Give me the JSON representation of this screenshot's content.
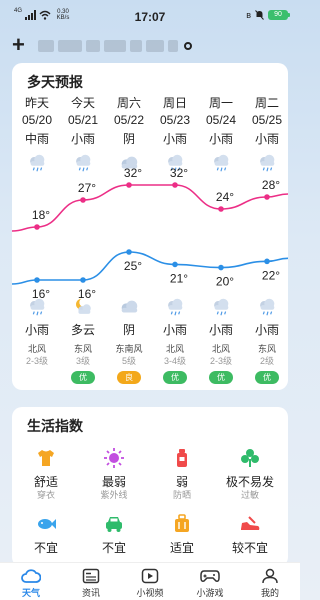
{
  "status_bar": {
    "network": "4G",
    "speed_value": "0.30",
    "speed_unit": "KB/s",
    "time": "17:07",
    "battery": "90"
  },
  "header": {
    "add_label": "+"
  },
  "forecast": {
    "title": "多天预报",
    "days": [
      {
        "name": "昨天",
        "date": "05/20",
        "day_cond": "中雨",
        "high": "18°",
        "low": "16°",
        "night_cond": "小雨",
        "wind_dir": "北风",
        "wind_level": "2-3级",
        "aqi": ""
      },
      {
        "name": "今天",
        "date": "05/21",
        "day_cond": "小雨",
        "high": "27°",
        "low": "16°",
        "night_cond": "多云",
        "wind_dir": "东风",
        "wind_level": "3级",
        "aqi": "优"
      },
      {
        "name": "周六",
        "date": "05/22",
        "day_cond": "阴",
        "high": "32°",
        "low": "25°",
        "night_cond": "阴",
        "wind_dir": "东南风",
        "wind_level": "5级",
        "aqi": "良"
      },
      {
        "name": "周日",
        "date": "05/23",
        "day_cond": "小雨",
        "high": "32°",
        "low": "21°",
        "night_cond": "小雨",
        "wind_dir": "北风",
        "wind_level": "3-4级",
        "aqi": "优"
      },
      {
        "name": "周一",
        "date": "05/24",
        "day_cond": "小雨",
        "high": "24°",
        "low": "20°",
        "night_cond": "小雨",
        "wind_dir": "北风",
        "wind_level": "2-3级",
        "aqi": "优"
      },
      {
        "name": "周二",
        "date": "05/25",
        "day_cond": "小雨",
        "high": "28°",
        "low": "22°",
        "night_cond": "小雨",
        "wind_dir": "东风",
        "wind_level": "2级",
        "aqi": "优"
      }
    ],
    "high_color": "#ec2e86",
    "low_color": "#2b8fe6",
    "aqi_colors": {
      "优": "#3dbb62",
      "良": "#f3a81a"
    }
  },
  "life": {
    "title": "生活指数",
    "items": [
      {
        "value": "舒适",
        "label": "穿衣",
        "icon": "shirt-icon"
      },
      {
        "value": "最弱",
        "label": "紫外线",
        "icon": "sun-icon"
      },
      {
        "value": "弱",
        "label": "防晒",
        "icon": "sunscreen-icon"
      },
      {
        "value": "极不易发",
        "label": "过敏",
        "icon": "allergy-icon"
      },
      {
        "value": "不宜",
        "label": "",
        "icon": "fish-icon"
      },
      {
        "value": "不宜",
        "label": "",
        "icon": "car-wash-icon"
      },
      {
        "value": "适宜",
        "label": "",
        "icon": "luggage-icon"
      },
      {
        "value": "较不宜",
        "label": "",
        "icon": "running-shoe-icon"
      }
    ]
  },
  "tabs": [
    {
      "label": "天气",
      "icon": "cloud-icon",
      "active": true
    },
    {
      "label": "资讯",
      "icon": "news-icon",
      "active": false
    },
    {
      "label": "小视频",
      "icon": "video-icon",
      "active": false
    },
    {
      "label": "小游戏",
      "icon": "gamepad-icon",
      "active": false
    },
    {
      "label": "我的",
      "icon": "user-icon",
      "active": false
    }
  ]
}
